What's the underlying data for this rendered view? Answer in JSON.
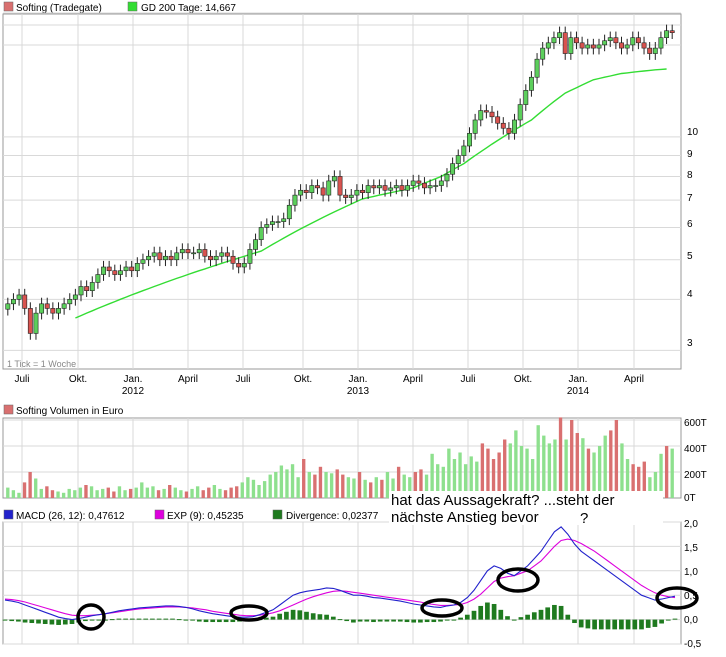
{
  "colors": {
    "up": "#5ccf5c",
    "down": "#d9534f",
    "ma200": "#33dd33",
    "volume_up": "#8ee08e",
    "volume_down": "#d97070",
    "macd": "#2222cc",
    "exp": "#dd00dd",
    "divergence": "#1f7a1f",
    "grid": "#d9d9d9",
    "annotation": "#000000"
  },
  "price_panel": {
    "legend": [
      {
        "label": "Softing (Tradegate)",
        "color": "#d97070"
      },
      {
        "label": "GD 200 Tage: 14,667",
        "color": "#33dd33"
      }
    ],
    "tick_note": "1 Tick = 1 Woche",
    "y_scale": "log",
    "y_ticks": [
      "3",
      "4",
      "5",
      "6",
      "7",
      "8",
      "9",
      "10"
    ],
    "x_months": [
      "Juli",
      "Okt.",
      "Jan.",
      "April",
      "Juli",
      "Okt.",
      "Jan.",
      "April",
      "Juli",
      "Okt.",
      "Jan.",
      "April"
    ],
    "x_years": [
      "2012",
      "2013",
      "2014"
    ]
  },
  "volume_panel": {
    "legend": [
      {
        "label": "Softing Volumen in Euro",
        "color": "#d97070"
      }
    ],
    "y_ticks": [
      "600T",
      "400T",
      "200T",
      "0T"
    ]
  },
  "macd_panel": {
    "legend": [
      {
        "label": "MACD (26, 12): 0,47612",
        "color": "#2222cc"
      },
      {
        "label": "EXP (9): 0,45235",
        "color": "#dd00dd"
      },
      {
        "label": "Divergence: 0,02377",
        "color": "#1f7a1f"
      }
    ],
    "y_ticks": [
      "2,0",
      "1,5",
      "1,0",
      "0,5",
      "0,0",
      "-0,5"
    ],
    "annotation_line1": "hat das Aussagekraft? ...steht der",
    "annotation_line2": "nächste Anstieg bevor",
    "annotation_q": "?"
  },
  "chart_data": [
    {
      "type": "candlestick",
      "title": "Softing (Tradegate)",
      "y_scale": "log",
      "ylim": [
        2.7,
        20
      ],
      "x_range": [
        "2011-06",
        "2014-06"
      ],
      "series": [
        {
          "name": "Softing (Tradegate)",
          "values_weekly_close": [
            3.9,
            4.0,
            4.1,
            3.8,
            3.3,
            3.7,
            3.9,
            3.8,
            3.7,
            3.8,
            3.9,
            4.0,
            4.1,
            4.3,
            4.2,
            4.4,
            4.6,
            4.8,
            4.7,
            4.6,
            4.7,
            4.8,
            4.7,
            4.9,
            5.0,
            5.1,
            5.2,
            5.0,
            5.1,
            5.0,
            5.2,
            5.3,
            5.2,
            5.2,
            5.3,
            5.1,
            5.0,
            5.1,
            5.2,
            5.1,
            4.9,
            4.8,
            4.9,
            5.3,
            5.6,
            6.0,
            6.1,
            6.2,
            6.2,
            6.3,
            6.8,
            7.2,
            7.4,
            7.3,
            7.6,
            7.5,
            7.2,
            7.8,
            8.0,
            7.2,
            7.1,
            7.2,
            7.4,
            7.3,
            7.6,
            7.5,
            7.6,
            7.4,
            7.5,
            7.6,
            7.4,
            7.6,
            7.8,
            7.7,
            7.5,
            7.6,
            7.6,
            7.8,
            8.1,
            8.6,
            9.0,
            9.5,
            10.2,
            11.0,
            11.6,
            11.5,
            11.2,
            10.8,
            10.5,
            10.2,
            11.0,
            12.0,
            13.0,
            14.0,
            15.5,
            16.5,
            17.0,
            17.5,
            18.0,
            16.0,
            17.5,
            17.0,
            16.5,
            16.8,
            16.5,
            16.8,
            17.2,
            17.5,
            17.0,
            16.5,
            16.8,
            17.5,
            17.0,
            16.5,
            16.0,
            16.5,
            17.5,
            18.2,
            18.0
          ]
        },
        {
          "name": "GD 200 Tage: 14,667",
          "values": [
            null,
            null,
            null,
            null,
            null,
            null,
            null,
            null,
            null,
            null,
            null,
            null,
            3.6,
            3.65,
            3.7,
            3.75,
            3.8,
            3.85,
            3.9,
            3.95,
            4.0,
            4.05,
            4.1,
            4.15,
            4.2,
            4.25,
            4.3,
            4.35,
            4.4,
            4.45,
            4.5,
            4.55,
            4.6,
            4.65,
            4.7,
            4.75,
            4.8,
            4.85,
            4.9,
            4.95,
            5.0,
            5.05,
            5.1,
            5.15,
            5.2,
            5.25,
            5.35,
            5.45,
            5.55,
            5.65,
            5.75,
            5.85,
            5.95,
            6.05,
            6.15,
            6.25,
            6.35,
            6.45,
            6.55,
            6.65,
            6.75,
            6.85,
            6.95,
            7.05,
            7.1,
            7.15,
            7.2,
            7.25,
            7.3,
            7.35,
            7.4,
            7.45,
            7.5,
            7.6,
            7.7,
            7.8,
            7.9,
            8.0,
            8.15,
            8.3,
            8.45,
            8.6,
            8.8,
            9.0,
            9.2,
            9.4,
            9.6,
            9.8,
            10.0,
            10.2,
            10.4,
            10.6,
            10.8,
            11.0,
            11.3,
            11.6,
            11.9,
            12.2,
            12.5,
            12.8,
            13.0,
            13.2,
            13.4,
            13.6,
            13.8,
            13.9,
            14.0,
            14.1,
            14.2,
            14.3,
            14.35,
            14.4,
            14.45,
            14.5,
            14.55,
            14.6,
            14.63,
            14.667
          ]
        }
      ]
    },
    {
      "type": "bar",
      "title": "Softing Volumen in Euro",
      "ylim": [
        0,
        600000
      ],
      "values": [
        80,
        60,
        40,
        120,
        200,
        150,
        70,
        90,
        60,
        50,
        40,
        70,
        60,
        80,
        100,
        90,
        60,
        70,
        80,
        50,
        90,
        60,
        70,
        80,
        120,
        80,
        90,
        60,
        70,
        100,
        80,
        60,
        50,
        70,
        90,
        60,
        80,
        100,
        70,
        60,
        80,
        90,
        120,
        160,
        140,
        100,
        130,
        180,
        200,
        250,
        220,
        260,
        160,
        300,
        200,
        180,
        240,
        200,
        190,
        220,
        180,
        160,
        150,
        200,
        140,
        120,
        160,
        140,
        200,
        150,
        240,
        180,
        160,
        200,
        220,
        180,
        340,
        260,
        240,
        380,
        300,
        350,
        260,
        320,
        280,
        420,
        380,
        300,
        350,
        450,
        420,
        520,
        400,
        380,
        300,
        560,
        480,
        420,
        450,
        620,
        450,
        600,
        500,
        460,
        380,
        350,
        400,
        480,
        520,
        600,
        420,
        300,
        260,
        240,
        280,
        160,
        200,
        340,
        400,
        380
      ]
    },
    {
      "type": "line",
      "title": "MACD (26, 12)",
      "ylim": [
        -0.5,
        2.0
      ],
      "series": [
        {
          "name": "MACD (26, 12): 0,47612",
          "values": [
            0.4,
            0.38,
            0.35,
            0.3,
            0.25,
            0.2,
            0.15,
            0.1,
            0.05,
            0.02,
            0.0,
            0.02,
            0.05,
            0.08,
            0.1,
            0.12,
            0.15,
            0.18,
            0.2,
            0.22,
            0.24,
            0.25,
            0.26,
            0.27,
            0.28,
            0.28,
            0.27,
            0.25,
            0.22,
            0.18,
            0.15,
            0.12,
            0.1,
            0.08,
            0.06,
            0.05,
            0.05,
            0.06,
            0.1,
            0.15,
            0.2,
            0.3,
            0.4,
            0.5,
            0.55,
            0.58,
            0.6,
            0.62,
            0.65,
            0.64,
            0.6,
            0.55,
            0.5,
            0.5,
            0.48,
            0.45,
            0.44,
            0.42,
            0.4,
            0.38,
            0.35,
            0.32,
            0.3,
            0.28,
            0.26,
            0.25,
            0.28,
            0.3,
            0.35,
            0.45,
            0.6,
            0.8,
            1.0,
            1.1,
            1.05,
            0.95,
            0.9,
            1.0,
            1.1,
            1.25,
            1.4,
            1.6,
            1.8,
            1.9,
            1.75,
            1.55,
            1.4,
            1.3,
            1.2,
            1.1,
            1.0,
            0.9,
            0.8,
            0.7,
            0.6,
            0.5,
            0.45,
            0.4,
            0.42,
            0.45,
            0.48
          ]
        },
        {
          "name": "EXP (9): 0,45235",
          "values": [
            0.42,
            0.41,
            0.39,
            0.36,
            0.32,
            0.28,
            0.24,
            0.2,
            0.16,
            0.12,
            0.09,
            0.08,
            0.08,
            0.09,
            0.1,
            0.12,
            0.14,
            0.16,
            0.18,
            0.2,
            0.22,
            0.23,
            0.24,
            0.25,
            0.26,
            0.26,
            0.26,
            0.25,
            0.24,
            0.22,
            0.2,
            0.17,
            0.15,
            0.13,
            0.11,
            0.09,
            0.08,
            0.08,
            0.09,
            0.11,
            0.14,
            0.18,
            0.24,
            0.3,
            0.36,
            0.42,
            0.47,
            0.51,
            0.55,
            0.58,
            0.59,
            0.58,
            0.56,
            0.54,
            0.52,
            0.5,
            0.48,
            0.46,
            0.44,
            0.42,
            0.4,
            0.38,
            0.36,
            0.33,
            0.31,
            0.29,
            0.29,
            0.3,
            0.31,
            0.35,
            0.42,
            0.52,
            0.65,
            0.78,
            0.85,
            0.88,
            0.9,
            0.95,
            1.0,
            1.1,
            1.2,
            1.35,
            1.5,
            1.62,
            1.65,
            1.62,
            1.56,
            1.48,
            1.4,
            1.3,
            1.2,
            1.1,
            1.0,
            0.9,
            0.8,
            0.7,
            0.62,
            0.55,
            0.5,
            0.47,
            0.45
          ]
        },
        {
          "name": "Divergence: 0,02377",
          "values": [
            -0.02,
            -0.03,
            -0.04,
            -0.06,
            -0.07,
            -0.08,
            -0.09,
            -0.1,
            -0.11,
            -0.1,
            -0.09,
            -0.06,
            -0.03,
            -0.01,
            0.0,
            0.0,
            0.01,
            0.02,
            0.02,
            0.02,
            0.02,
            0.02,
            0.02,
            0.02,
            0.02,
            0.02,
            0.01,
            0.0,
            -0.02,
            -0.04,
            -0.05,
            -0.05,
            -0.05,
            -0.05,
            -0.05,
            -0.04,
            -0.03,
            -0.02,
            0.01,
            0.04,
            0.06,
            0.12,
            0.16,
            0.2,
            0.19,
            0.16,
            0.13,
            0.11,
            0.1,
            0.06,
            0.01,
            -0.03,
            -0.06,
            -0.04,
            -0.04,
            -0.05,
            -0.04,
            -0.04,
            -0.04,
            -0.04,
            -0.05,
            -0.06,
            -0.06,
            -0.05,
            -0.05,
            -0.04,
            -0.01,
            0.0,
            0.04,
            0.1,
            0.18,
            0.28,
            0.35,
            0.32,
            0.2,
            0.07,
            0.0,
            0.05,
            0.1,
            0.15,
            0.2,
            0.25,
            0.3,
            0.28,
            0.1,
            -0.07,
            -0.16,
            -0.18,
            -0.2,
            -0.2,
            -0.2,
            -0.2,
            -0.2,
            -0.2,
            -0.2,
            -0.2,
            -0.17,
            -0.15,
            -0.08,
            -0.02,
            0.02
          ]
        }
      ]
    }
  ]
}
